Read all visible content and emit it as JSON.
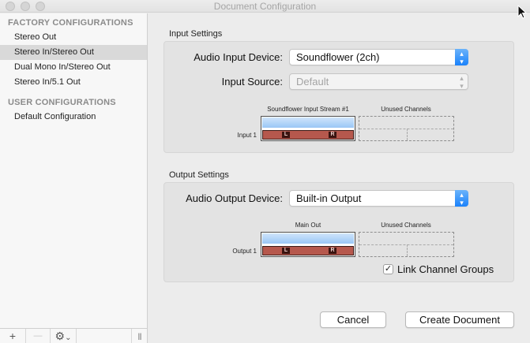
{
  "window": {
    "title": "Document Configuration"
  },
  "sidebar": {
    "factory_header": "FACTORY CONFIGURATIONS",
    "factory_items": [
      {
        "label": "Stereo Out"
      },
      {
        "label": "Stereo In/Stereo Out"
      },
      {
        "label": "Dual Mono In/Stereo Out"
      },
      {
        "label": "Stereo In/5.1 Out"
      }
    ],
    "selected_item": "Stereo In/Stereo Out",
    "user_header": "USER CONFIGURATIONS",
    "user_items": [
      {
        "label": "Default Configuration"
      }
    ],
    "toolbar": {
      "add": "+",
      "remove": "—",
      "gear": "⚙",
      "gear_chevron": "⌄",
      "resize": "|||"
    }
  },
  "input_settings": {
    "title": "Input Settings",
    "device_label": "Audio Input Device:",
    "device_value": "Soundflower (2ch)",
    "source_label": "Input Source:",
    "source_value": "Default",
    "stream_caption": "Soundflower Input Stream #1",
    "unused_caption": "Unused Channels",
    "row_label": "Input 1",
    "left_chip": "L",
    "right_chip": "R"
  },
  "output_settings": {
    "title": "Output Settings",
    "device_label": "Audio Output Device:",
    "device_value": "Built-in Output",
    "stream_caption": "Main Out",
    "unused_caption": "Unused Channels",
    "row_label": "Output 1",
    "left_chip": "L",
    "right_chip": "R",
    "link_label": "Link Channel Groups",
    "link_checked": true,
    "link_mark": "✓"
  },
  "buttons": {
    "cancel": "Cancel",
    "create": "Create Document"
  },
  "colors": {
    "accent": "#1a82fb",
    "selection": "#d9d9d9",
    "channel_red": "#b6584d",
    "channel_blue": "#9ac7f6"
  },
  "icons": {
    "popup_arrows": "⌃⌄"
  }
}
